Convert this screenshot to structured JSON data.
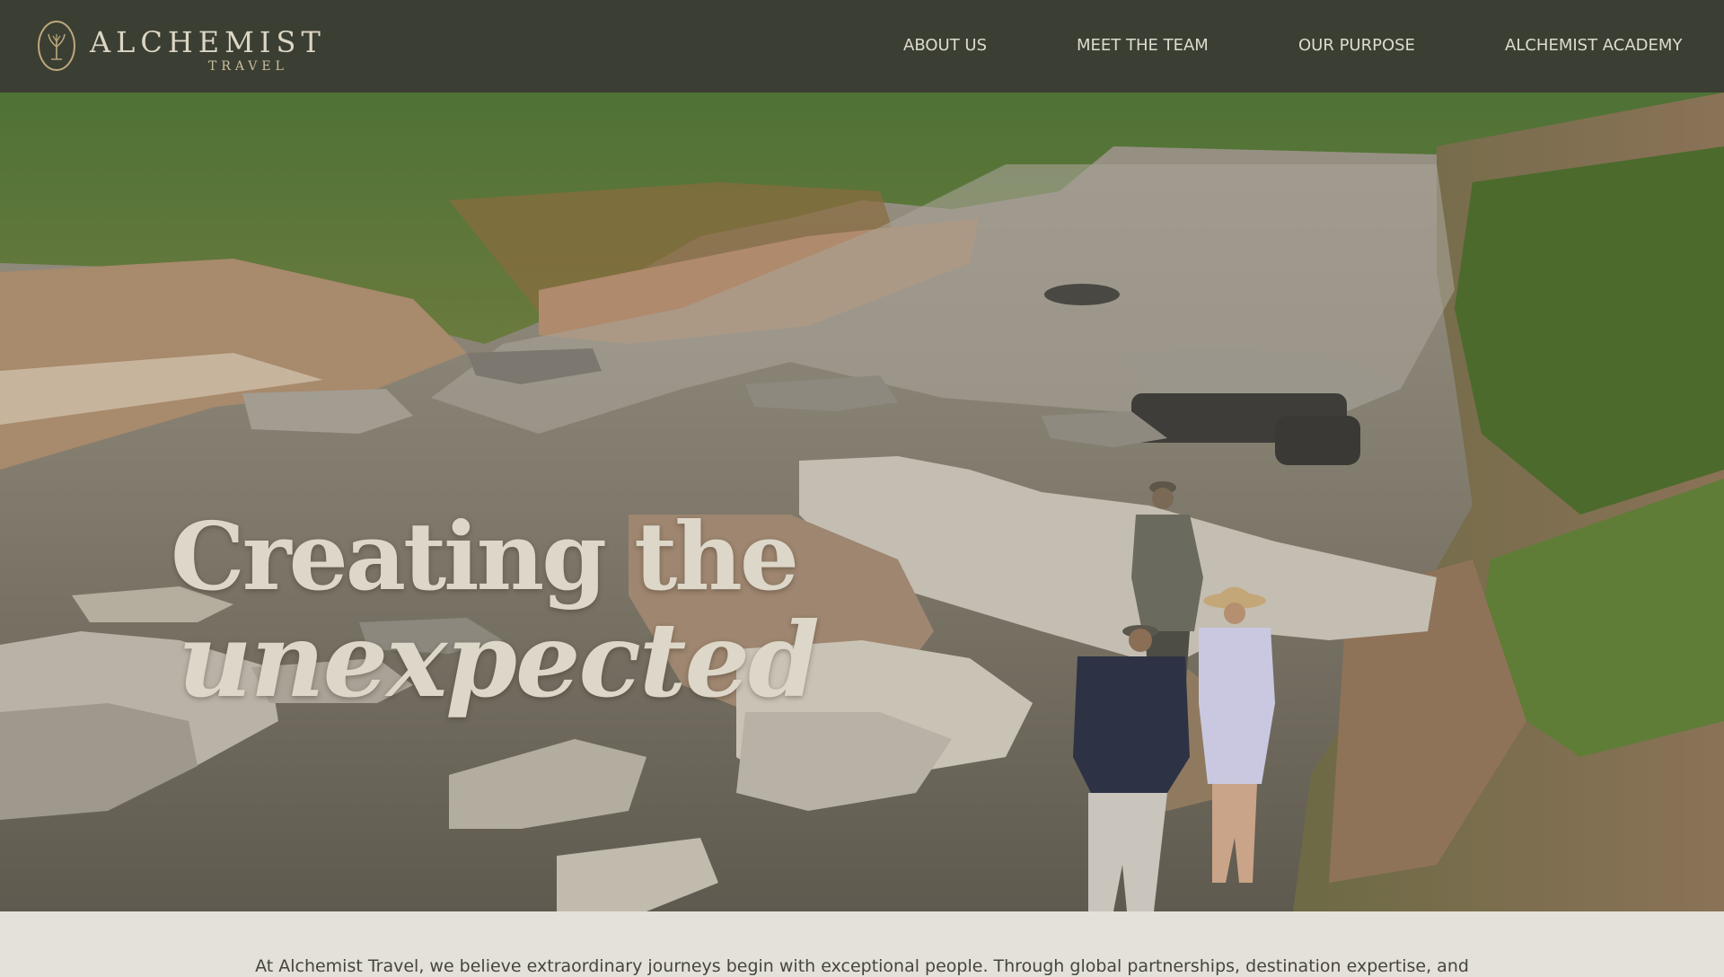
{
  "brand": {
    "name": "ALCHEMIST",
    "sub": "TRAVEL",
    "icon": "ornamental-emblem-icon",
    "colors": {
      "header_bg": "#3b3f33",
      "logo_text": "#dcd6c4",
      "logo_gold": "#cbbf9e"
    }
  },
  "nav": {
    "items": [
      {
        "label": "ABOUT US"
      },
      {
        "label": "MEET THE TEAM"
      },
      {
        "label": "OUR PURPOSE"
      },
      {
        "label": "ALCHEMIST ACADEMY"
      }
    ]
  },
  "hero": {
    "headline_line1": "Creating the",
    "headline_line2": "unexpected",
    "text_color": "#ddd7c9"
  },
  "intro": {
    "text": "At Alchemist Travel, we believe extraordinary journeys begin with exceptional people. Through global partnerships, destination expertise, and",
    "band_color": "#e4e2d8"
  }
}
